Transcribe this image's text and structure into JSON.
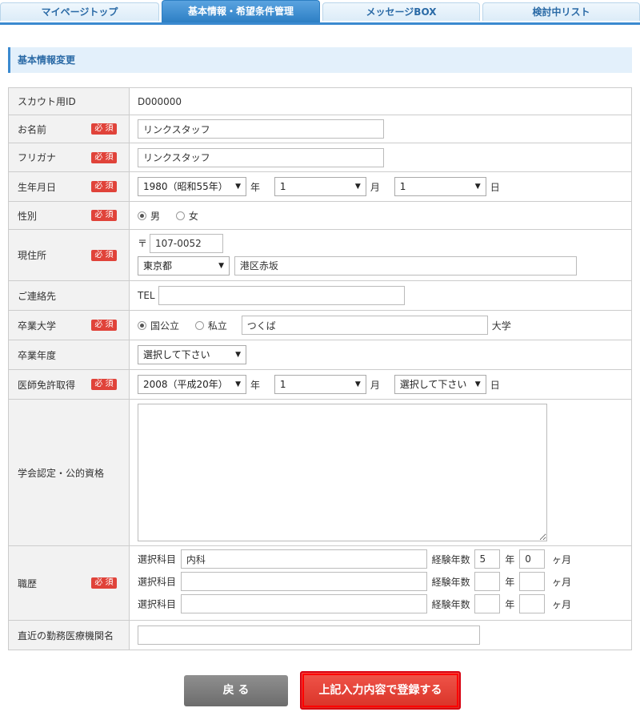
{
  "tabs": [
    {
      "label": "マイページトップ"
    },
    {
      "label": "基本情報・希望条件管理"
    },
    {
      "label": "メッセージBOX"
    },
    {
      "label": "検討中リスト"
    }
  ],
  "section_title": "基本情報変更",
  "required_label": "必 須",
  "fields": {
    "scout_id": {
      "label": "スカウト用ID",
      "value": "D000000"
    },
    "name": {
      "label": "お名前",
      "value": "リンクスタッフ"
    },
    "kana": {
      "label": "フリガナ",
      "value": "リンクスタッフ"
    },
    "birth": {
      "label": "生年月日",
      "year": "1980（昭和55年）",
      "year_unit": "年",
      "month": "1",
      "month_unit": "月",
      "day": "1",
      "day_unit": "日"
    },
    "gender": {
      "label": "性別",
      "male": "男",
      "female": "女",
      "selected": "男"
    },
    "address": {
      "label": "現住所",
      "postal_mark": "〒",
      "postal": "107-0052",
      "prefecture": "東京都",
      "city": "港区赤坂"
    },
    "contact": {
      "label": "ご連絡先",
      "tel_label": "TEL",
      "tel": ""
    },
    "university": {
      "label": "卒業大学",
      "public": "国公立",
      "private": "私立",
      "selected": "国公立",
      "name": "つくば",
      "suffix": "大学"
    },
    "grad_year": {
      "label": "卒業年度",
      "value": "選択して下さい"
    },
    "license": {
      "label": "医師免許取得",
      "year": "2008（平成20年）",
      "year_unit": "年",
      "month": "1",
      "month_unit": "月",
      "day": "選択して下さい",
      "day_unit": "日"
    },
    "certification": {
      "label": "学会認定・公的資格",
      "value": ""
    },
    "career": {
      "label": "職歴",
      "subject_label": "選択科目",
      "years_label": "経験年数",
      "year_unit": "年",
      "month_unit": "ヶ月",
      "rows": [
        {
          "subject": "内科",
          "years": "5",
          "months": "0"
        },
        {
          "subject": "",
          "years": "",
          "months": ""
        },
        {
          "subject": "",
          "years": "",
          "months": ""
        }
      ]
    },
    "recent_hospital": {
      "label": "直近の勤務医療機関名",
      "value": ""
    }
  },
  "buttons": {
    "back": "戻 る",
    "submit": "上記入力内容で登録する"
  },
  "colors": {
    "accent": "#3b8ad0",
    "required": "#e0433a",
    "submit": "#e0433a",
    "back": "#7a7a7a"
  }
}
